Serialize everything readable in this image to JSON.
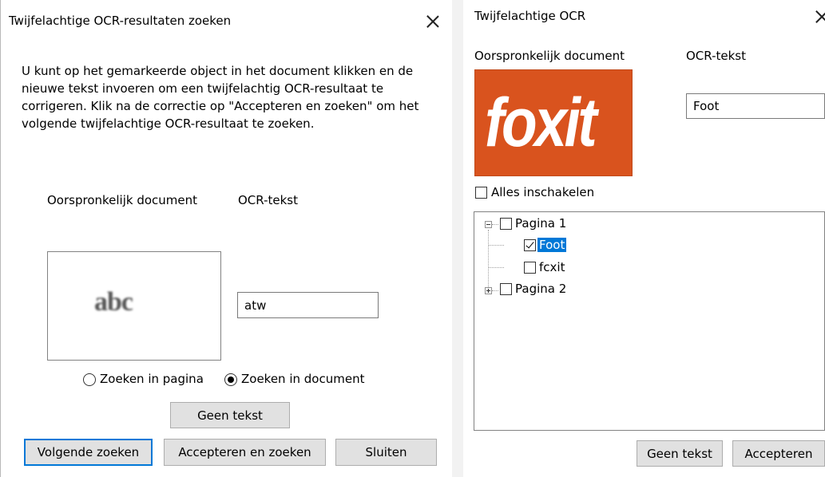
{
  "left_dialog": {
    "title": "Twijfelachtige OCR-resultaten zoeken",
    "instructions": "U kunt op het gemarkeerde object in het document klikken en de nieuwe tekst invoeren om een twijfelachtig OCR-resultaat te corrigeren. Klik na de correctie op \"Accepteren en zoeken\" om het volgende twijfelachtige OCR-resultaat te zoeken.",
    "label_original": "Oorspronkelijk document",
    "label_ocr": "OCR-tekst",
    "preview_text": "abc",
    "ocr_value": "atw",
    "radio_page": "Zoeken in pagina",
    "radio_document": "Zoeken in document",
    "radio_selected": "document",
    "btn_no_text": "Geen tekst",
    "btn_next": "Volgende zoeken",
    "btn_accept_search": "Accepteren en zoeken",
    "btn_close": "Sluiten"
  },
  "right_dialog": {
    "title": "Twijfelachtige OCR",
    "label_original": "Oorspronkelijk document",
    "label_ocr": "OCR-tekst",
    "preview_logo_text": "foxit",
    "ocr_value": "Foot",
    "enable_all": "Alles inschakelen",
    "tree": {
      "page1": "Pagina 1",
      "item1": "Foot",
      "item2": "fcxit",
      "page2": "Pagina 2"
    },
    "btn_no_text": "Geen tekst",
    "btn_accept": "Accepteren"
  },
  "colors": {
    "accent": "#0078d7",
    "logo_bg": "#d9531e"
  }
}
